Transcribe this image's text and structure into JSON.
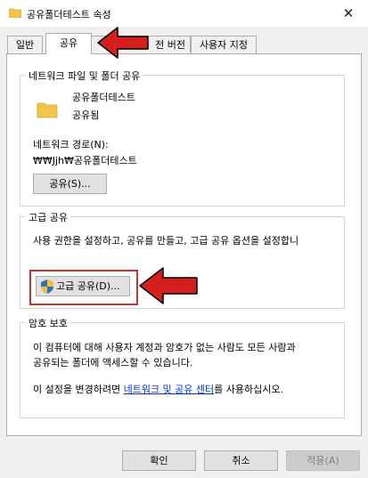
{
  "window": {
    "title": "공유폴더테스트 속성",
    "close_glyph": "✕"
  },
  "tabs": [
    {
      "label": "일반"
    },
    {
      "label": "공유",
      "active": true
    },
    {
      "label": "전 버전"
    },
    {
      "label": "사용자 지정"
    }
  ],
  "network_share": {
    "group_label": "네트워크 파일 및 폴더 공유",
    "folder_name": "공유폴더테스트",
    "status": "공유됨",
    "path_label": "네트워크 경로(N):",
    "path_value": "₩₩Jjh₩공유폴더테스트",
    "share_button": "공유(S)..."
  },
  "advanced_share": {
    "group_label": "고급 공유",
    "description": "사용 권한을 설정하고, 공유를 만들고, 고급 공유 옵션을 설정합니",
    "button_label": "고급 공유(D)..."
  },
  "password": {
    "group_label": "암호 보호",
    "line1": "이 컴퓨터에 대해 사용자 계정과 암호가 없는 사람도 모든 사람과",
    "line2": "공유되는 폴더에 액세스할 수 있습니다.",
    "change_prefix": "이 설정을 변경하려면 ",
    "link_text": "네트워크 및 공유 센터",
    "change_suffix": "를 사용하십시오."
  },
  "buttons": {
    "ok": "확인",
    "cancel": "취소",
    "apply": "적용(A)"
  },
  "colors": {
    "highlight": "#c8332f",
    "arrow_fill": "#d41f1f",
    "link": "#0033cc",
    "folder": "#f3c54d"
  }
}
